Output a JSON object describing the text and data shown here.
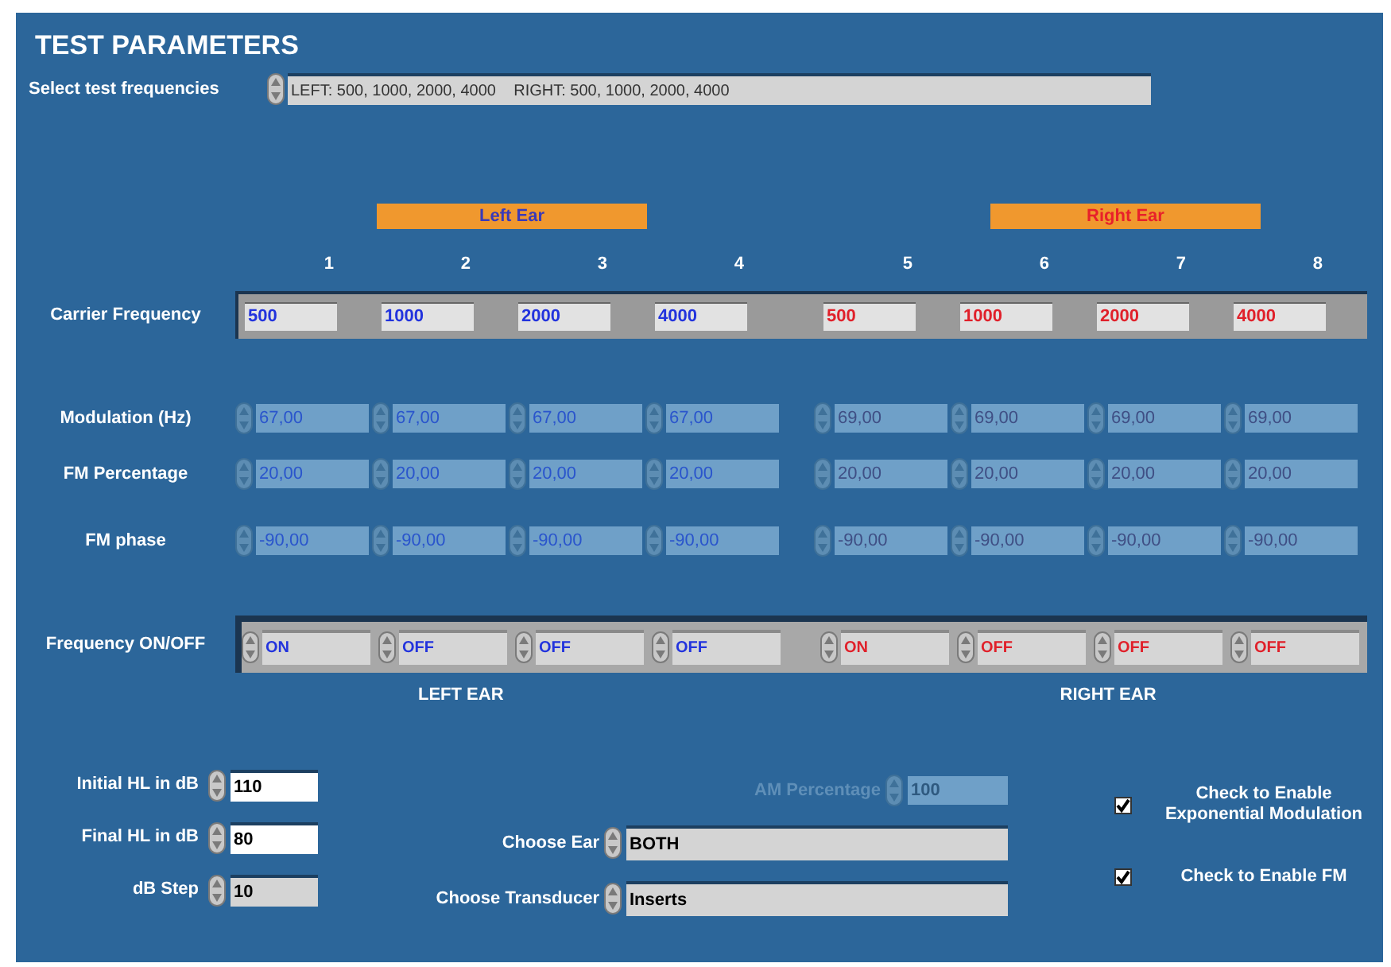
{
  "title": "TEST PARAMETERS",
  "frequency_selector": {
    "label": "Select test frequencies",
    "value": "LEFT: 500, 1000, 2000, 4000    RIGHT: 500, 1000, 2000, 4000"
  },
  "ear_headers": [
    {
      "label": "Left Ear",
      "kind": "left"
    },
    {
      "label": "Right Ear",
      "kind": "right"
    }
  ],
  "column_numbers": [
    "1",
    "2",
    "3",
    "4",
    "5",
    "6",
    "7",
    "8"
  ],
  "rows": [
    {
      "kind": "carrier",
      "label": "Carrier Frequency",
      "disabled": false,
      "values": [
        {
          "value": "500",
          "kind": "left"
        },
        {
          "value": "1000",
          "kind": "left"
        },
        {
          "value": "2000",
          "kind": "left"
        },
        {
          "value": "4000",
          "kind": "left"
        },
        {
          "value": "500",
          "kind": "right"
        },
        {
          "value": "1000",
          "kind": "right"
        },
        {
          "value": "2000",
          "kind": "right"
        },
        {
          "value": "4000",
          "kind": "right"
        }
      ]
    },
    {
      "kind": "numeric",
      "label": "Modulation (Hz)",
      "disabled": true,
      "values": [
        {
          "value": "67,00",
          "kind": "left"
        },
        {
          "value": "67,00",
          "kind": "left"
        },
        {
          "value": "67,00",
          "kind": "left"
        },
        {
          "value": "67,00",
          "kind": "left"
        },
        {
          "value": "69,00",
          "kind": "right"
        },
        {
          "value": "69,00",
          "kind": "right"
        },
        {
          "value": "69,00",
          "kind": "right"
        },
        {
          "value": "69,00",
          "kind": "right"
        }
      ]
    },
    {
      "kind": "numeric",
      "label": "FM Percentage",
      "disabled": true,
      "values": [
        {
          "value": "20,00",
          "kind": "left"
        },
        {
          "value": "20,00",
          "kind": "left"
        },
        {
          "value": "20,00",
          "kind": "left"
        },
        {
          "value": "20,00",
          "kind": "left"
        },
        {
          "value": "20,00",
          "kind": "right"
        },
        {
          "value": "20,00",
          "kind": "right"
        },
        {
          "value": "20,00",
          "kind": "right"
        },
        {
          "value": "20,00",
          "kind": "right"
        }
      ]
    },
    {
      "kind": "numeric",
      "label": "FM phase",
      "disabled": true,
      "values": [
        {
          "value": "-90,00",
          "kind": "left"
        },
        {
          "value": "-90,00",
          "kind": "left"
        },
        {
          "value": "-90,00",
          "kind": "left"
        },
        {
          "value": "-90,00",
          "kind": "left"
        },
        {
          "value": "-90,00",
          "kind": "right"
        },
        {
          "value": "-90,00",
          "kind": "right"
        },
        {
          "value": "-90,00",
          "kind": "right"
        },
        {
          "value": "-90,00",
          "kind": "right"
        }
      ]
    },
    {
      "kind": "switch",
      "label": "Frequency ON/OFF",
      "disabled": false,
      "values": [
        {
          "value": "ON",
          "kind": "left"
        },
        {
          "value": "OFF",
          "kind": "left"
        },
        {
          "value": "OFF",
          "kind": "left"
        },
        {
          "value": "OFF",
          "kind": "left"
        },
        {
          "value": "ON",
          "kind": "right"
        },
        {
          "value": "OFF",
          "kind": "right"
        },
        {
          "value": "OFF",
          "kind": "right"
        },
        {
          "value": "OFF",
          "kind": "right"
        }
      ]
    }
  ],
  "ear_labels": [
    "LEFT EAR",
    "RIGHT EAR"
  ],
  "level_fields": [
    {
      "label": "Initial HL in dB",
      "value": "110",
      "kind": "control"
    },
    {
      "label": "Final HL in dB",
      "value": "80",
      "kind": "control"
    },
    {
      "label": "dB Step",
      "value": "10",
      "kind": "indicator"
    }
  ],
  "am_percentage": {
    "label": "AM Percentage",
    "value": "100",
    "disabled": true
  },
  "rings": [
    {
      "label": "Choose Ear",
      "value": "BOTH"
    },
    {
      "label": "Choose Transducer",
      "value": "Inserts"
    }
  ],
  "checkboxes": [
    {
      "label": "Check to Enable Exponential Modulation",
      "checked": true
    },
    {
      "label": "Check to Enable FM",
      "checked": true
    }
  ]
}
